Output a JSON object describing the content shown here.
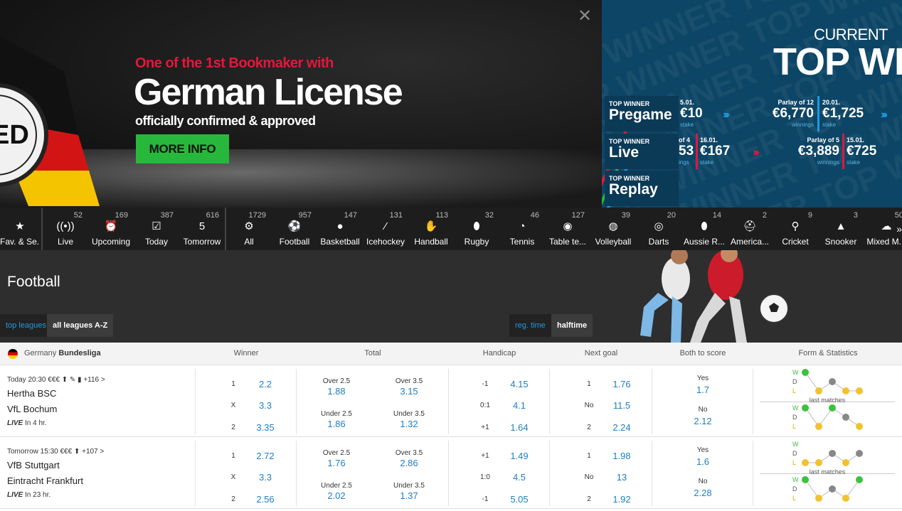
{
  "banner": {
    "tagline": "One of the 1st Bookmaker with",
    "title": "German License",
    "subtitle": "officially confirmed & approved",
    "cta": "MORE INFO",
    "seal_text": "ED",
    "top_winner": {
      "current": "CURRENT",
      "headline": "TOP WIN",
      "rows": [
        {
          "small": "TOP WINNER",
          "big": "Pregame",
          "cells": [
            {
              "s": "5.01.",
              "v": "€10",
              "m": "stake"
            },
            {
              "s": "Parlay of 12",
              "v": "€6,770",
              "m": "winnings"
            },
            {
              "s": "20.01.",
              "v": "€1,725",
              "m": "stake"
            }
          ]
        },
        {
          "small": "TOP WINNER",
          "big": "Live",
          "cells": [
            {
              "s": "of 4",
              "v": "53",
              "m": "ings"
            },
            {
              "s": "16.01.",
              "v": "€167",
              "m": "stake"
            },
            {
              "s": "Parlay of 5",
              "v": "€3,889",
              "m": "winnings"
            },
            {
              "s": "15.01.",
              "v": "€725",
              "m": "stake"
            }
          ]
        },
        {
          "small": "TOP WINNER",
          "big": "Replay",
          "cells": []
        }
      ]
    }
  },
  "nav": [
    {
      "label": "Fav. & Se...",
      "count": "",
      "icon": "★"
    },
    {
      "label": "Live",
      "count": "52",
      "icon": "((•))"
    },
    {
      "label": "Upcoming",
      "count": "169",
      "icon": "⏰"
    },
    {
      "label": "Today",
      "count": "387",
      "icon": "☑"
    },
    {
      "label": "Tomorrow",
      "count": "616",
      "icon": "5"
    },
    {
      "label": "All",
      "count": "1729",
      "icon": "⚙"
    },
    {
      "label": "Football",
      "count": "957",
      "icon": "⚽"
    },
    {
      "label": "Basketball",
      "count": "147",
      "icon": "●"
    },
    {
      "label": "Icehockey",
      "count": "131",
      "icon": "⁄"
    },
    {
      "label": "Handball",
      "count": "113",
      "icon": "✋"
    },
    {
      "label": "Rugby",
      "count": "32",
      "icon": "⬮"
    },
    {
      "label": "Tennis",
      "count": "46",
      "icon": "◔"
    },
    {
      "label": "Table te...",
      "count": "127",
      "icon": "◉"
    },
    {
      "label": "Volleyball",
      "count": "39",
      "icon": "◍"
    },
    {
      "label": "Darts",
      "count": "20",
      "icon": "◎"
    },
    {
      "label": "Aussie R...",
      "count": "14",
      "icon": "⬮"
    },
    {
      "label": "America...",
      "count": "2",
      "icon": "⛑"
    },
    {
      "label": "Cricket",
      "count": "9",
      "icon": "⚲"
    },
    {
      "label": "Snooker",
      "count": "3",
      "icon": "▲"
    },
    {
      "label": "Mixed M...",
      "count": "50",
      "icon": "☁"
    }
  ],
  "section": {
    "title": "Football",
    "tab_top": "top leagues",
    "tab_all": "all leagues A-Z",
    "tab_reg": "reg. time",
    "tab_half": "halftime"
  },
  "table": {
    "league_country": "Germany",
    "league_name": "Bundesliga",
    "headers": [
      "Winner",
      "Total",
      "Handicap",
      "Next goal",
      "Both to score",
      "Form & Statistics"
    ],
    "last_matches": "last matches",
    "form_letters": [
      "W",
      "D",
      "L"
    ],
    "rows": [
      {
        "meta": "Today 20:30 €€€ ⬆ ✎ ▮  +116 >",
        "home": "Hertha BSC",
        "away": "VfL Bochum",
        "live": "LIVE",
        "live_in": "In 4 hr.",
        "winner": [
          {
            "k": "1",
            "o": "2.2"
          },
          {
            "k": "X",
            "o": "3.3"
          },
          {
            "k": "2",
            "o": "3.35"
          }
        ],
        "total": [
          {
            "k": "Over 2.5",
            "o": "1.88"
          },
          {
            "k": "Over 3.5",
            "o": "3.15"
          },
          {
            "k": "Under 2.5",
            "o": "1.86"
          },
          {
            "k": "Under 3.5",
            "o": "1.32"
          }
        ],
        "handicap": [
          {
            "k": "-1",
            "o": "4.15"
          },
          {
            "k": "0:1",
            "o": "4.1"
          },
          {
            "k": "+1",
            "o": "1.64"
          }
        ],
        "next_goal": [
          {
            "k": "1",
            "o": "1.76"
          },
          {
            "k": "No",
            "o": "11.5"
          },
          {
            "k": "2",
            "o": "2.24"
          }
        ],
        "both": [
          {
            "k": "Yes",
            "o": "1.7"
          },
          {
            "k": "No",
            "o": "2.12"
          }
        ],
        "form_home": [
          "W",
          "L",
          "D",
          "L",
          "L"
        ],
        "form_away": [
          "W",
          "L",
          "W",
          "D",
          "L"
        ]
      },
      {
        "meta": "Tomorrow 15:30 €€€ ⬆  +107 >",
        "home": "VfB Stuttgart",
        "away": "Eintracht Frankfurt",
        "live": "LIVE",
        "live_in": "In 23 hr.",
        "winner": [
          {
            "k": "1",
            "o": "2.72"
          },
          {
            "k": "X",
            "o": "3.3"
          },
          {
            "k": "2",
            "o": "2.56"
          }
        ],
        "total": [
          {
            "k": "Over 2.5",
            "o": "1.76"
          },
          {
            "k": "Over 3.5",
            "o": "2.86"
          },
          {
            "k": "Under 2.5",
            "o": "2.02"
          },
          {
            "k": "Under 3.5",
            "o": "1.37"
          }
        ],
        "handicap": [
          {
            "k": "+1",
            "o": "1.49"
          },
          {
            "k": "1:0",
            "o": "4.5"
          },
          {
            "k": "-1",
            "o": "5.05"
          }
        ],
        "next_goal": [
          {
            "k": "1",
            "o": "1.98"
          },
          {
            "k": "No",
            "o": "13"
          },
          {
            "k": "2",
            "o": "1.92"
          }
        ],
        "both": [
          {
            "k": "Yes",
            "o": "1.6"
          },
          {
            "k": "No",
            "o": "2.28"
          }
        ],
        "form_home": [
          "L",
          "L",
          "D",
          "L",
          "D"
        ],
        "form_away": [
          "W",
          "L",
          "D",
          "L",
          "W"
        ]
      }
    ]
  },
  "colors": {
    "accent": "#1b7fc4",
    "cta": "#27b83b",
    "promo": "#e4163c",
    "form_win": "#3cc23c",
    "form_draw": "#888888",
    "form_loss": "#f2c12e"
  }
}
